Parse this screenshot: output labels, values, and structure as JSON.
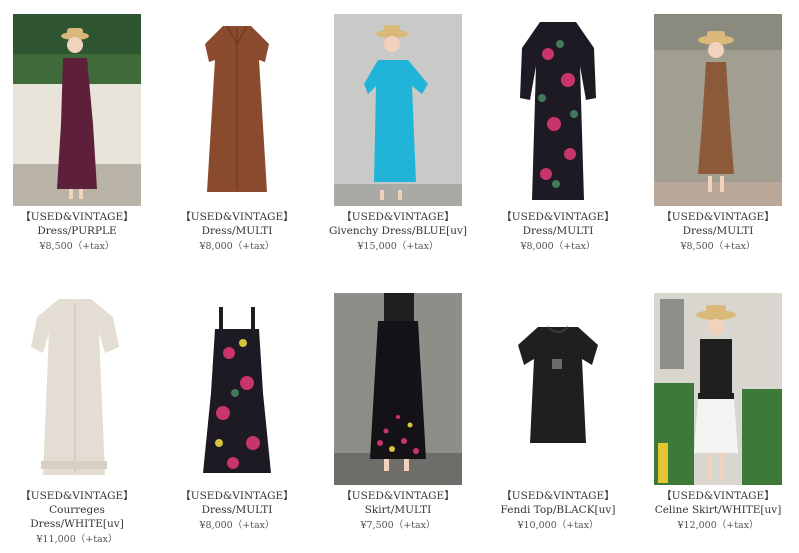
{
  "products": [
    {
      "tag": "【USED&VINTAGE】",
      "name": "Dress/PURPLE",
      "price": "¥8,500（+tax）",
      "image": "purple-sleeveless-maxi-dress-photo"
    },
    {
      "tag": "【USED&VINTAGE】",
      "name": "Dress/MULTI",
      "price": "¥8,000（+tax）",
      "image": "brown-shirt-dress-photo"
    },
    {
      "tag": "【USED&VINTAGE】",
      "name": "Givenchy Dress/BLUE[uv]",
      "price": "¥15,000（+tax）",
      "image": "blue-givenchy-dress-photo"
    },
    {
      "tag": "【USED&VINTAGE】",
      "name": "Dress/MULTI",
      "price": "¥8,000（+tax）",
      "image": "floral-wrap-dress-photo"
    },
    {
      "tag": "【USED&VINTAGE】",
      "name": "Dress/MULTI",
      "price": "¥8,500（+tax）",
      "image": "brown-check-dress-photo"
    },
    {
      "tag": "【USED&VINTAGE】",
      "name": "Courreges Dress/WHITE[uv]",
      "price": "¥11,000（+tax）",
      "image": "white-courreges-dress-photo"
    },
    {
      "tag": "【USED&VINTAGE】",
      "name": "Dress/MULTI",
      "price": "¥8,000（+tax）",
      "image": "floral-slip-dress-photo"
    },
    {
      "tag": "【USED&VINTAGE】",
      "name": "Skirt/MULTI",
      "price": "¥7,500（+tax）",
      "image": "black-floral-skirt-photo"
    },
    {
      "tag": "【USED&VINTAGE】",
      "name": "Fendi Top/BLACK[uv]",
      "price": "¥10,000（+tax）",
      "image": "black-fendi-top-photo"
    },
    {
      "tag": "【USED&VINTAGE】",
      "name": "Celine Skirt/WHITE[uv]",
      "price": "¥12,000（+tax）",
      "image": "white-celine-skirt-photo"
    }
  ],
  "colors": {
    "purple": "#5e1f3a",
    "brown": "#8a4a2e",
    "blue": "#20b5d8",
    "floral_dark": "#1e1a24",
    "floral_pink": "#c8356a",
    "floral_green": "#3f7a5a",
    "check_brown": "#8c5a38",
    "cream": "#e3ddd3",
    "black": "#1f1f1f",
    "white": "#f4f4f2"
  }
}
